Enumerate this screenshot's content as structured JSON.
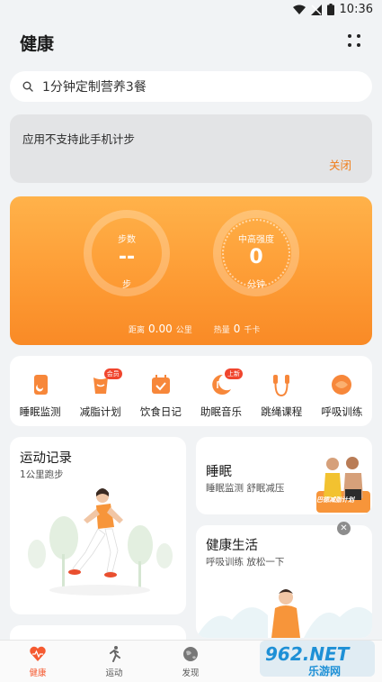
{
  "status_bar": {
    "time": "10:36"
  },
  "header": {
    "title": "健康"
  },
  "search": {
    "text": "1分钟定制营养3餐"
  },
  "notice": {
    "message": "应用不支持此手机计步",
    "close_label": "关闭"
  },
  "hero": {
    "steps_label": "步数",
    "steps_value": "--",
    "steps_unit": "步",
    "intensity_label": "中高强度",
    "intensity_value": "0",
    "intensity_unit": "分钟",
    "distance_label": "距离",
    "distance_value": "0.00",
    "distance_unit": "公里",
    "calorie_label": "热量",
    "calorie_value": "0",
    "calorie_unit": "千卡"
  },
  "shortcuts": [
    {
      "label": "睡眠监测",
      "icon": "phone-sleep-icon"
    },
    {
      "label": "减脂计划",
      "icon": "body-icon",
      "badge": "会员"
    },
    {
      "label": "饮食日记",
      "icon": "calendar-check-icon"
    },
    {
      "label": "助眠音乐",
      "icon": "moon-music-icon",
      "badge": "上新"
    },
    {
      "label": "跳绳课程",
      "icon": "jump-rope-icon"
    },
    {
      "label": "呼吸训练",
      "icon": "breath-icon"
    }
  ],
  "cards": {
    "exercise": {
      "title": "运动记录",
      "subtitle": "1公里跑步"
    },
    "sleep": {
      "title": "睡眠",
      "subtitle": "睡眠监测 舒眠减压",
      "promo": "巴德减脂计划"
    },
    "life": {
      "title": "健康生活",
      "subtitle": "呼吸训练 放松一下"
    }
  },
  "bottom_nav": [
    {
      "label": "健康",
      "icon": "heart-pulse-icon",
      "active": true
    },
    {
      "label": "运动",
      "icon": "runner-icon",
      "active": false
    },
    {
      "label": "发现",
      "icon": "globe-icon",
      "active": false
    }
  ],
  "watermark": {
    "brand": "962.NET",
    "sub": "乐游网"
  },
  "colors": {
    "accent": "#f98a26",
    "active_nav": "#f55a30",
    "badge": "#f0452d"
  }
}
